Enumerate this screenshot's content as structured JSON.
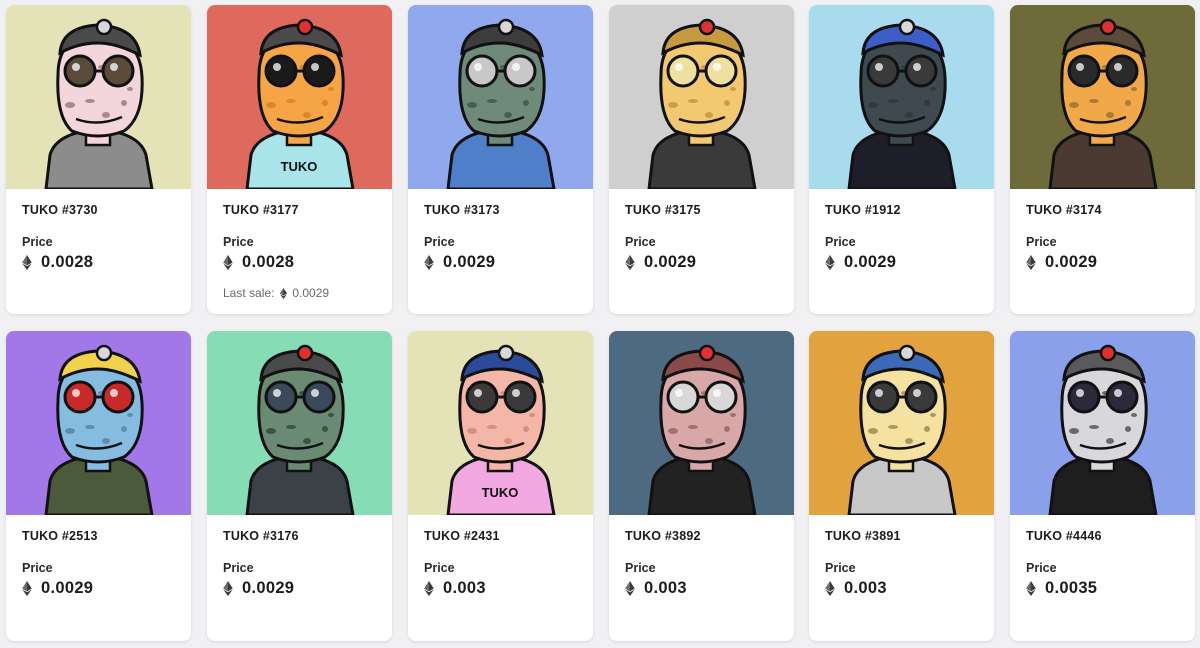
{
  "price_label": "Price",
  "last_sale_label": "Last sale:",
  "currency_icon": "ethereum-icon",
  "cards": [
    {
      "name": "TUKO #3730",
      "price": "0.0028",
      "last_sale": null,
      "bg": "#e4e3b8",
      "skin": "#f2d6dc",
      "spots": "#8a6a6a",
      "outfit": "#8c8c8c",
      "hat": "#4a4a4a",
      "eye": "#5a4a3a"
    },
    {
      "name": "TUKO #3177",
      "price": "0.0028",
      "last_sale": "0.0029",
      "bg": "#de6a5e",
      "skin": "#f5a545",
      "spots": "#d07a20",
      "outfit": "#a8e4ea",
      "hat": "#4a4a4a",
      "eye": "#1a1a1a",
      "shirt_text": "TUKO"
    },
    {
      "name": "TUKO #3173",
      "price": "0.0029",
      "last_sale": null,
      "bg": "#8fa8ee",
      "skin": "#6f8a78",
      "spots": "#3a4a40",
      "outfit": "#4e7fc8",
      "hat": "#3d3d3d",
      "eye": "#c8c8c8"
    },
    {
      "name": "TUKO #3175",
      "price": "0.0029",
      "last_sale": null,
      "bg": "#cfcfcf",
      "skin": "#f2c870",
      "spots": "#c08a30",
      "outfit": "#3a3a3a",
      "hat": "#c89a40",
      "eye": "#f0e0a0"
    },
    {
      "name": "TUKO #1912",
      "price": "0.0029",
      "last_sale": null,
      "bg": "#a9dbee",
      "skin": "#3e4a50",
      "spots": "#2a3236",
      "outfit": "#1e1e2a",
      "hat": "#3c5ec8",
      "eye": "#3a3a3a"
    },
    {
      "name": "TUKO #3174",
      "price": "0.0029",
      "last_sale": null,
      "bg": "#6e6a3a",
      "skin": "#f0a848",
      "spots": "#8a6a30",
      "outfit": "#4a3a32",
      "hat": "#5a4a3a",
      "eye": "#2a2a2a"
    },
    {
      "name": "TUKO #2513",
      "price": "0.0029",
      "last_sale": null,
      "bg": "#a277e8",
      "skin": "#86bce0",
      "spots": "#4a7aa0",
      "outfit": "#4a5a3a",
      "hat": "#f2d24a",
      "eye": "#c82a2a"
    },
    {
      "name": "TUKO #3176",
      "price": "0.0029",
      "last_sale": null,
      "bg": "#86dcb4",
      "skin": "#6a8a74",
      "spots": "#2a3a30",
      "outfit": "#3a4248",
      "hat": "#4a4a4a",
      "eye": "#3a4a5a"
    },
    {
      "name": "TUKO #2431",
      "price": "0.003",
      "last_sale": null,
      "bg": "#e4e3b8",
      "skin": "#f4b6a6",
      "spots": "#c88070",
      "outfit": "#f2a8e0",
      "hat": "#2a4a9a",
      "eye": "#3a3a3a",
      "shirt_text": "TUKO"
    },
    {
      "name": "TUKO #3892",
      "price": "0.003",
      "last_sale": null,
      "bg": "#4e6a80",
      "skin": "#d8a8a8",
      "spots": "#8a5a5a",
      "outfit": "#222222",
      "hat": "#8a4a4a",
      "eye": "#d8d8d8"
    },
    {
      "name": "TUKO #3891",
      "price": "0.003",
      "last_sale": null,
      "bg": "#e2a23e",
      "skin": "#f6e2a0",
      "spots": "#8a7a40",
      "outfit": "#c8c8c8",
      "hat": "#3a6ab8",
      "eye": "#3a3a3a"
    },
    {
      "name": "TUKO #4446",
      "price": "0.0035",
      "last_sale": null,
      "bg": "#8aa0ea",
      "skin": "#d8d8dc",
      "spots": "#3a3a3a",
      "outfit": "#1e1e1e",
      "hat": "#5a5a5a",
      "eye": "#2a2a3a"
    }
  ]
}
